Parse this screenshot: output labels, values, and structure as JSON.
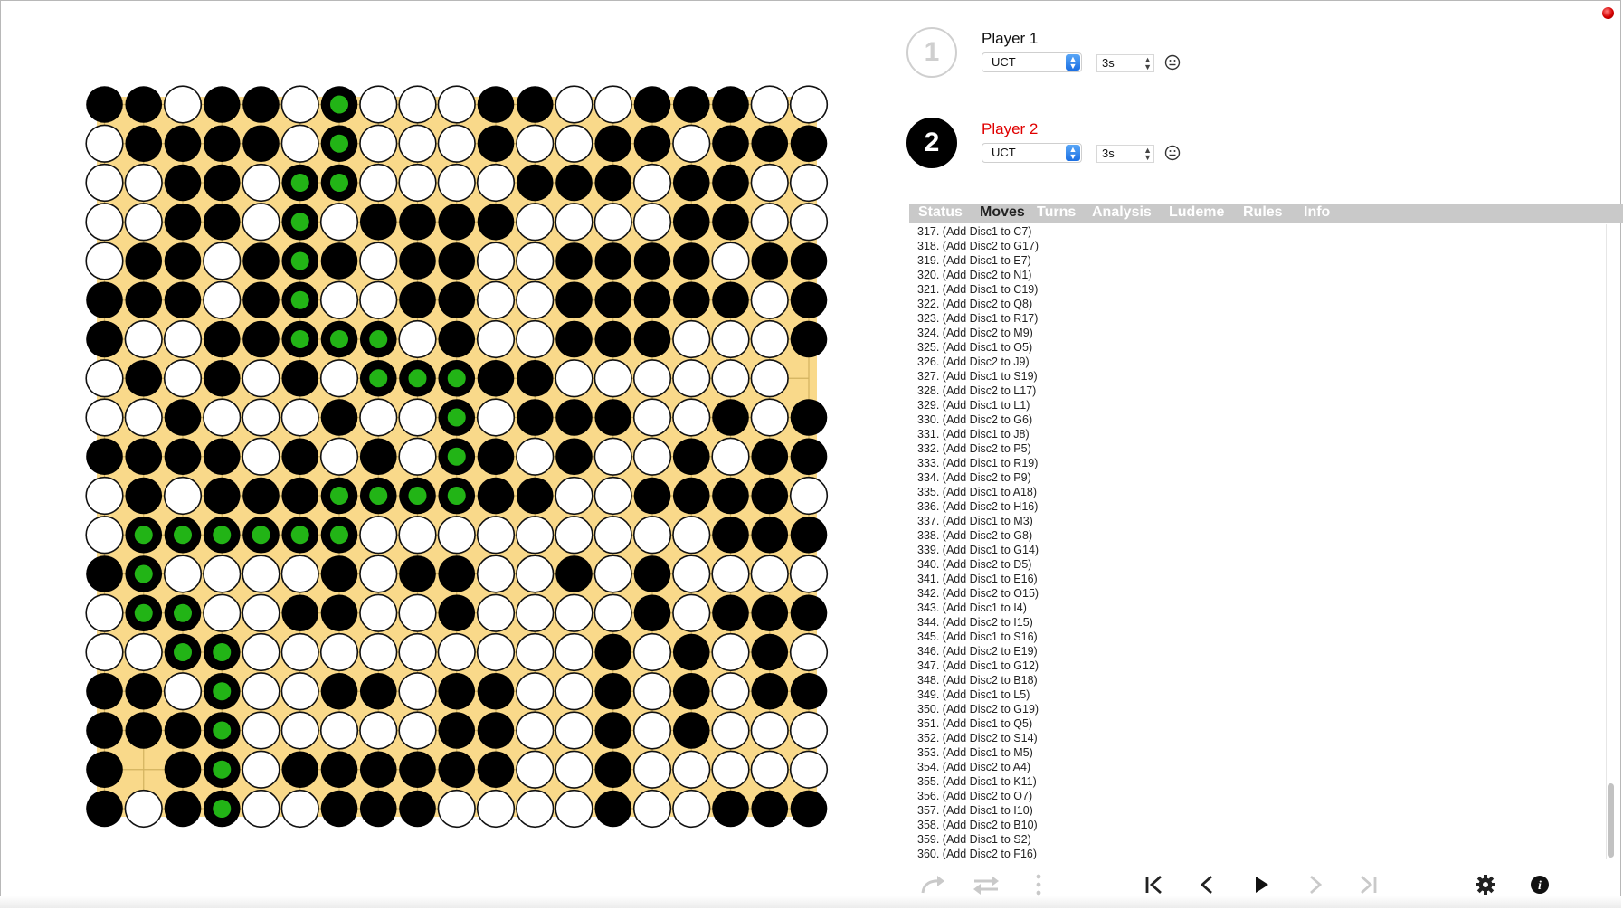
{
  "board": {
    "size": 19,
    "rows": [
      "BBWBBWGWWWBBWWBBBWW",
      "WBBBBWGWWWBWWBBWBBB",
      "WWBBWGGWWWWBBBWBBWW",
      "WWBBWGWBBBBWWWWBBWW",
      "WBBWBGBWBBWWBBBBWBB",
      "BBBWBGWWBBWWBBBBBWB",
      "BWWBBGGGWBWWBBBWWWB",
      "WBWBWBWGGGBBWWWWWWE",
      "WWBWWWBWWGWBBBWWBWB",
      "BBBBWBWBWGBWBWWBWBB",
      "WBWBBBGGGGBBWWBBBBW",
      "WGGGGGGWWWWWWWWWBBB",
      "BGWWWWBWBBWWBWBWWWW",
      "WGGWWBBWWBWWWWBWBBB",
      "WWGGWWWWWWWWWBWBWBW",
      "BBWGWWBBWBBWWBWBWBB",
      "BBBGWWWWWBBWWBWBWWW",
      "BEBGWBBBBBBWWBWWWWW",
      "BWBGWWBBBWWWWBWWBBB"
    ],
    "colors": {
      "board": "#f9d98a",
      "line": "#d2b25f",
      "black": "#000000",
      "white": "#ffffff",
      "green": "#22b416"
    }
  },
  "players": [
    {
      "number": "1",
      "name": "Player 1",
      "ai": "UCT",
      "time": "3s",
      "active": false
    },
    {
      "number": "2",
      "name": "Player 2",
      "ai": "UCT",
      "time": "3s",
      "active": true
    }
  ],
  "tabs": [
    "Status",
    "Moves",
    "Turns",
    "Analysis",
    "Ludeme",
    "Rules",
    "Info"
  ],
  "active_tab": "Moves",
  "moves": [
    "317. (Add Disc1 to C7)",
    "318. (Add Disc2 to G17)",
    "319. (Add Disc1 to E7)",
    "320. (Add Disc2 to N1)",
    "321. (Add Disc1 to C19)",
    "322. (Add Disc2 to Q8)",
    "323. (Add Disc1 to R17)",
    "324. (Add Disc2 to M9)",
    "325. (Add Disc1 to O5)",
    "326. (Add Disc2 to J9)",
    "327. (Add Disc1 to S19)",
    "328. (Add Disc2 to L17)",
    "329. (Add Disc1 to L1)",
    "330. (Add Disc2 to G6)",
    "331. (Add Disc1 to J8)",
    "332. (Add Disc2 to P5)",
    "333. (Add Disc1 to R19)",
    "334. (Add Disc2 to P9)",
    "335. (Add Disc1 to A18)",
    "336. (Add Disc2 to H16)",
    "337. (Add Disc1 to M3)",
    "338. (Add Disc2 to G8)",
    "339. (Add Disc1 to G14)",
    "340. (Add Disc2 to D5)",
    "341. (Add Disc1 to E16)",
    "342. (Add Disc2 to O15)",
    "343. (Add Disc1 to I4)",
    "344. (Add Disc2 to I15)",
    "345. (Add Disc1 to S16)",
    "346. (Add Disc2 to E19)",
    "347. (Add Disc1 to G12)",
    "348. (Add Disc2 to B18)",
    "349. (Add Disc1 to L5)",
    "350. (Add Disc2 to G19)",
    "351. (Add Disc1 to Q5)",
    "352. (Add Disc2 to S14)",
    "353. (Add Disc1 to M5)",
    "354. (Add Disc2 to A4)",
    "355. (Add Disc1 to K11)",
    "356. (Add Disc2 to O7)",
    "357. (Add Disc1 to I10)",
    "358. (Add Disc2 to B10)",
    "359. (Add Disc1 to S2)",
    "360. (Add Disc2 to F16)"
  ],
  "controls": {
    "icons": [
      "redo-icon",
      "swap-icon",
      "more-icon",
      "first-move-icon",
      "previous-move-icon",
      "play-icon",
      "next-move-icon",
      "last-move-icon",
      "settings-icon",
      "info-icon"
    ]
  }
}
